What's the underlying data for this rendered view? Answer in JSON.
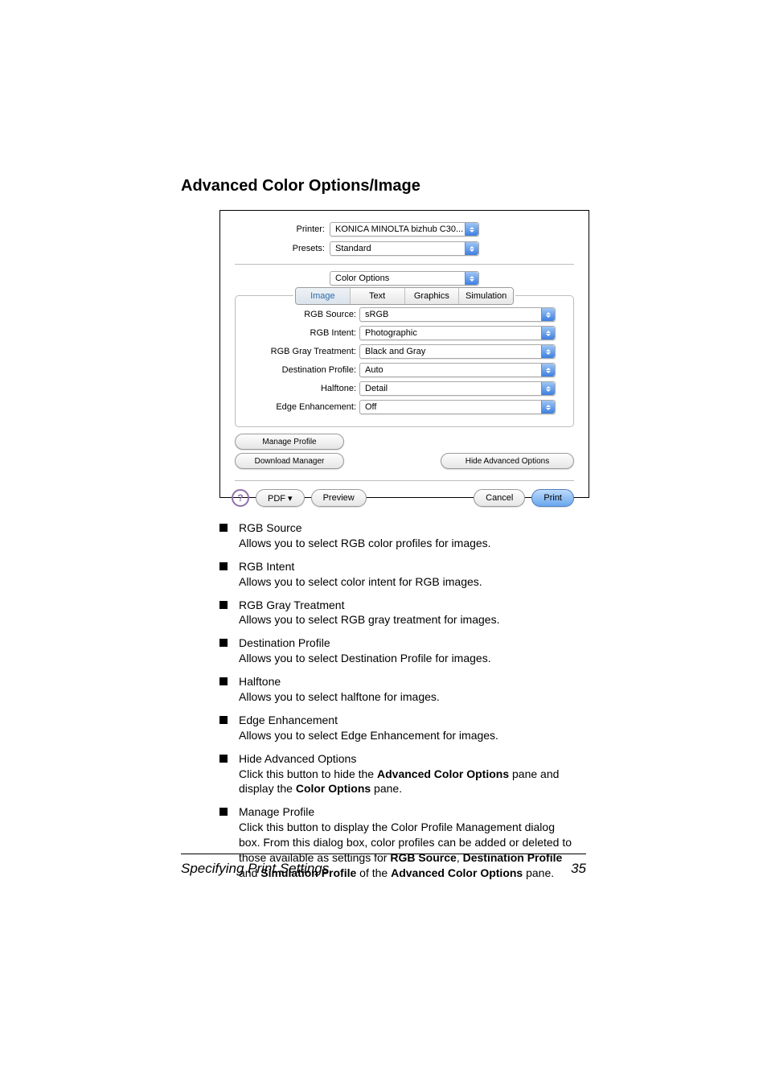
{
  "heading": "Advanced Color Options/Image",
  "dialog": {
    "printerLabel": "Printer:",
    "printerValue": "KONICA MINOLTA bizhub C30...",
    "presetsLabel": "Presets:",
    "presetsValue": "Standard",
    "sectionValue": "Color Options",
    "tabs": {
      "image": "Image",
      "text": "Text",
      "graphics": "Graphics",
      "simulation": "Simulation"
    },
    "rows": {
      "rgbSourceLabel": "RGB Source:",
      "rgbSourceValue": "sRGB",
      "rgbIntentLabel": "RGB Intent:",
      "rgbIntentValue": "Photographic",
      "rgbGrayLabel": "RGB Gray Treatment:",
      "rgbGrayValue": "Black and Gray",
      "destProfileLabel": "Destination Profile:",
      "destProfileValue": "Auto",
      "halftoneLabel": "Halftone:",
      "halftoneValue": "Detail",
      "edgeEnhLabel": "Edge Enhancement:",
      "edgeEnhValue": "Off"
    },
    "manageProfile": "Manage Profile",
    "downloadManager": "Download Manager",
    "hideAdvanced": "Hide Advanced Options",
    "help": "?",
    "pdf": "PDF ▾",
    "preview": "Preview",
    "cancel": "Cancel",
    "print": "Print"
  },
  "bullets": {
    "b1t": "RGB Source",
    "b1d": "Allows you to select RGB color profiles for images.",
    "b2t": "RGB Intent",
    "b2d": "Allows you to select color intent for RGB images.",
    "b3t": "RGB Gray Treatment",
    "b3d": "Allows you to select RGB gray treatment for images.",
    "b4t": "Destination Profile",
    "b4d": "Allows you to select Destination Profile for images.",
    "b5t": "Halftone",
    "b5d": "Allows you to select halftone for images.",
    "b6t": "Edge Enhancement",
    "b6d": "Allows you to select Edge Enhancement for images.",
    "b7t": "Hide Advanced Options",
    "b7d1": "Click this button to hide the ",
    "b7d2": "Advanced Color Options",
    "b7d3": " pane and display the ",
    "b7d4": "Color Options",
    "b7d5": " pane.",
    "b8t": "Manage Profile",
    "b8d1": "Click this button to display the Color Profile Management dialog box. From this dialog box, color profiles can be added or deleted to those available as settings for ",
    "b8d2": "RGB Source",
    "b8d3": ", ",
    "b8d4": "Destination Profile",
    "b8d5": " and ",
    "b8d6": "Simulation Profile",
    "b8d7": " of the ",
    "b8d8": "Advanced Color Options",
    "b8d9": " pane."
  },
  "footer": {
    "title": "Specifying Print Settings",
    "page": "35"
  }
}
